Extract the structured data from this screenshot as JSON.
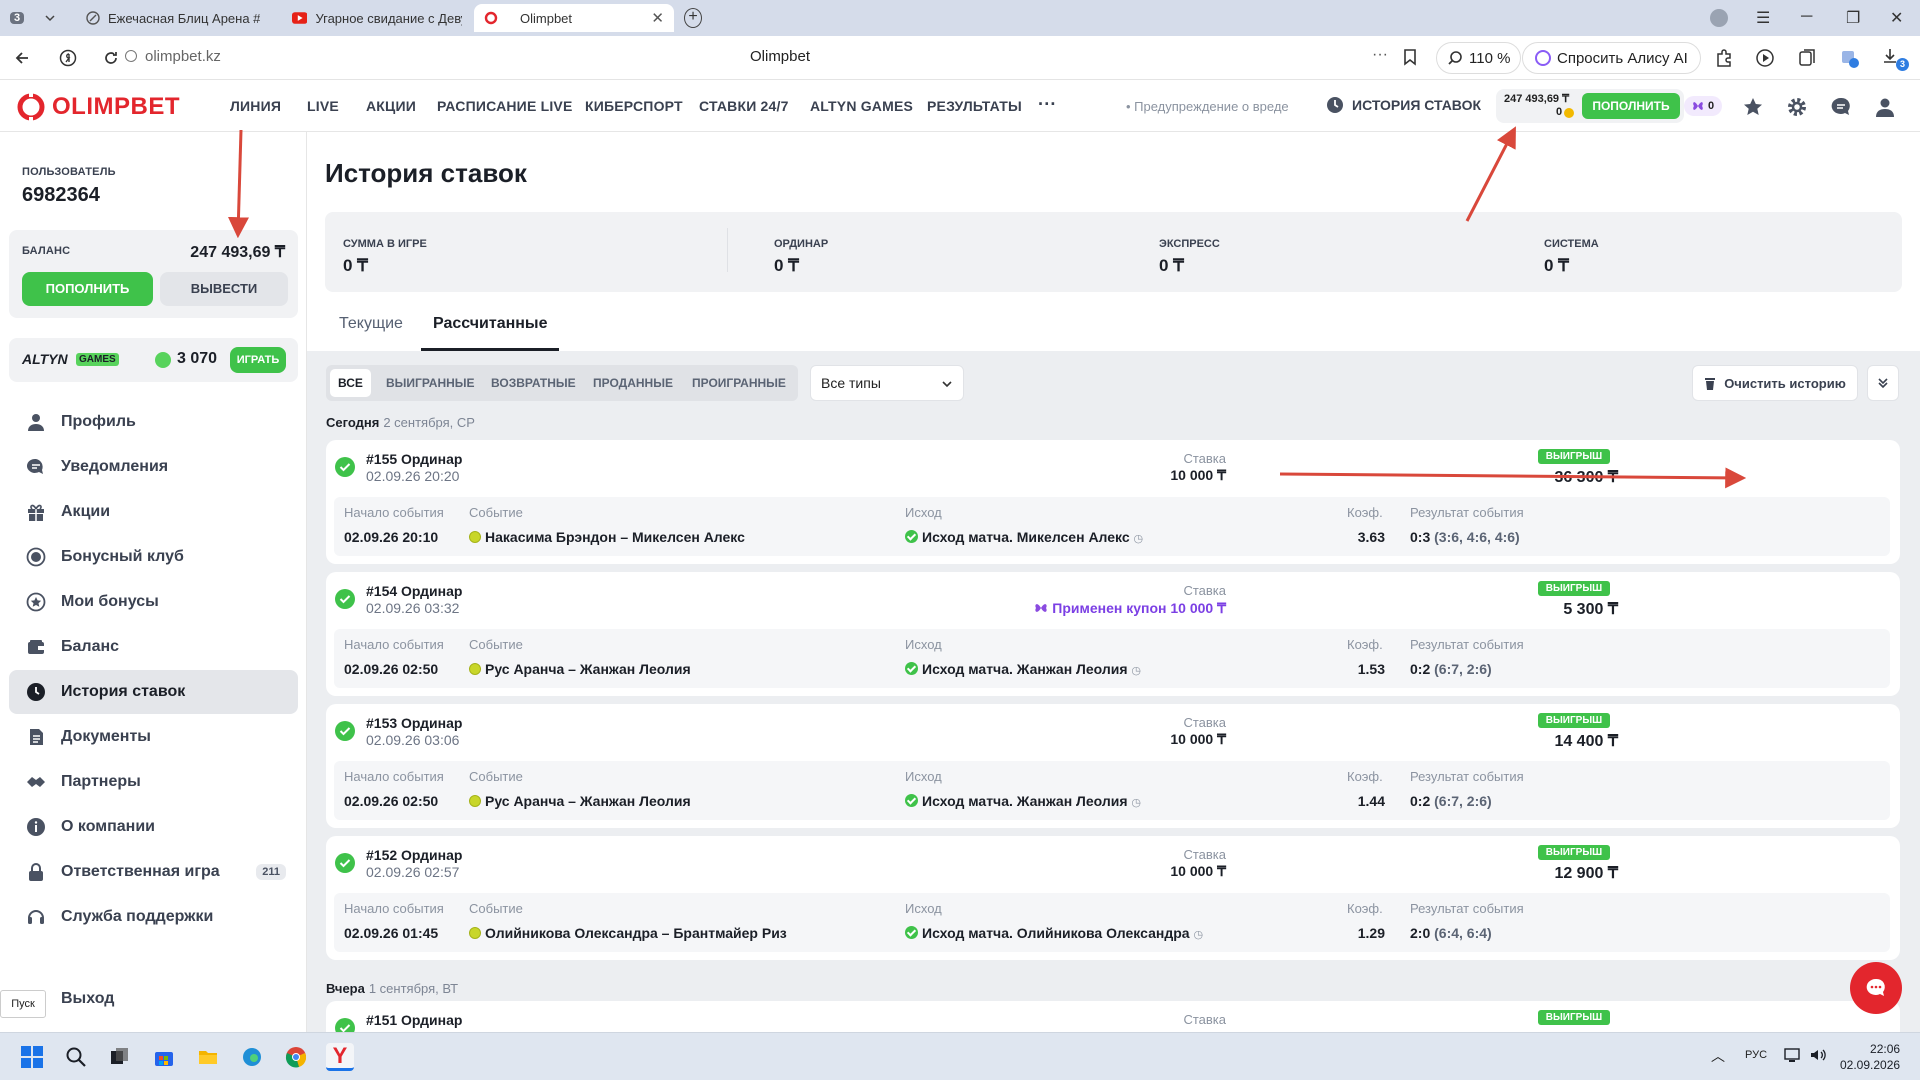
{
  "browser": {
    "tab_count": "3",
    "tabs": [
      {
        "title": "Ежечасная Блиц Арена #"
      },
      {
        "title": "Угарное свидание с Деву"
      },
      {
        "title": "Olimpbet"
      }
    ],
    "url": "olimpbet.kz",
    "page_title": "Olimpbet",
    "zoom": "110 %",
    "alisa_label": "Спросить Алису AI",
    "ext_badge": "3"
  },
  "site": {
    "logo": "OLIMPBET",
    "nav": [
      "ЛИНИЯ",
      "LIVE",
      "АКЦИИ",
      "РАСПИСАНИЕ LIVE",
      "КИБЕРСПОРТ",
      "СТАВКИ 24/7",
      "ALTYN GAMES",
      "РЕЗУЛЬТАТЫ"
    ],
    "more": "···",
    "warning": "• Предупреждение о вреде",
    "history_link": "ИСТОРИЯ СТАВОК",
    "header_balance": "247 493,69 ₸",
    "header_bonus": "0",
    "deposit_label": "ПОПОЛНИТЬ",
    "promo_count": "0"
  },
  "sidebar": {
    "user_label": "ПОЛЬЗОВАТЕЛЬ",
    "user_id": "6982364",
    "balance_label": "БАЛАНС",
    "balance": "247 493,69 ₸",
    "deposit": "ПОПОЛНИТЬ",
    "withdraw": "ВЫВЕСТИ",
    "altyn_logo": "ALTYN",
    "altyn_games": "GAMES",
    "altyn_points": "3 070",
    "altyn_play": "ИГРАТЬ",
    "menu": [
      {
        "label": "Профиль"
      },
      {
        "label": "Уведомления"
      },
      {
        "label": "Акции"
      },
      {
        "label": "Бонусный клуб"
      },
      {
        "label": "Мои бонусы"
      },
      {
        "label": "Баланс"
      },
      {
        "label": "История ставок"
      },
      {
        "label": "Документы"
      },
      {
        "label": "Партнеры"
      },
      {
        "label": "О компании"
      },
      {
        "label": "Ответственная игра",
        "count": "211"
      },
      {
        "label": "Служба поддержки"
      }
    ],
    "logout": "Выход"
  },
  "main": {
    "title": "История ставок",
    "summary": [
      {
        "label": "СУММА В ИГРЕ",
        "value": "0 ₸"
      },
      {
        "label": "ОРДИНАР",
        "value": "0 ₸"
      },
      {
        "label": "ЭКСПРЕСС",
        "value": "0 ₸"
      },
      {
        "label": "СИСТЕМА",
        "value": "0 ₸"
      }
    ],
    "tabs": [
      "Текущие",
      "Рассчитанные"
    ],
    "filters": [
      "ВСЕ",
      "ВЫИГРАННЫЕ",
      "ВОЗВРАТНЫЕ",
      "ПРОДАННЫЕ",
      "ПРОИГРАННЫЕ"
    ],
    "type_select": "Все типы",
    "clear_history": "Очистить историю",
    "day_today": "Сегодня",
    "day_today_date": "2 сентября, СР",
    "day_yesterday": "Вчера",
    "day_yesterday_date": "1 сентября, ВТ",
    "col_start": "Начало события",
    "col_event": "Событие",
    "col_outcome": "Исход",
    "col_coef": "Коэф.",
    "col_result": "Результат события",
    "stake_label": "Ставка",
    "win_badge": "ВЫИГРЫШ",
    "bets": [
      {
        "id": "#155 Ординар",
        "date": "02.09.26 20:20",
        "stake": "10 000 ₸",
        "payout": "36 300 ₸",
        "start": "02.09.26 20:10",
        "event": "Накасима Брэндон – Микелсен Алекс",
        "outcome": "Исход матча. Микелсен Алекс",
        "coef": "3.63",
        "result": "0:3",
        "result_detail": "(3:6, 4:6, 4:6)"
      },
      {
        "id": "#154 Ординар",
        "date": "02.09.26 03:32",
        "coupon": "Применен купон 10 000 ₸",
        "payout": "5 300 ₸",
        "start": "02.09.26 02:50",
        "event": "Рус Аранча – Жанжан Леолия",
        "outcome": "Исход матча. Жанжан Леолия",
        "coef": "1.53",
        "result": "0:2",
        "result_detail": "(6:7, 2:6)"
      },
      {
        "id": "#153 Ординар",
        "date": "02.09.26 03:06",
        "stake": "10 000 ₸",
        "payout": "14 400 ₸",
        "start": "02.09.26 02:50",
        "event": "Рус Аранча – Жанжан Леолия",
        "outcome": "Исход матча. Жанжан Леолия",
        "coef": "1.44",
        "result": "0:2",
        "result_detail": "(6:7, 2:6)"
      },
      {
        "id": "#152 Ординар",
        "date": "02.09.26 02:57",
        "stake": "10 000 ₸",
        "payout": "12 900 ₸",
        "start": "02.09.26 01:45",
        "event": "Олийникова Олександра – Брантмайер Риз",
        "outcome": "Исход матча. Олийникова Олександра",
        "coef": "1.29",
        "result": "2:0",
        "result_detail": "(6:4, 6:4)"
      }
    ],
    "partial_bet": {
      "id": "#151 Ординар"
    }
  },
  "taskbar": {
    "tooltip": "Пуск",
    "lang": "РУС",
    "time": "22:06",
    "date": "02.09.2026"
  },
  "colors": {
    "brand_red": "#e3262d",
    "green": "#3fc24a",
    "annotation_red": "#d9483b"
  }
}
